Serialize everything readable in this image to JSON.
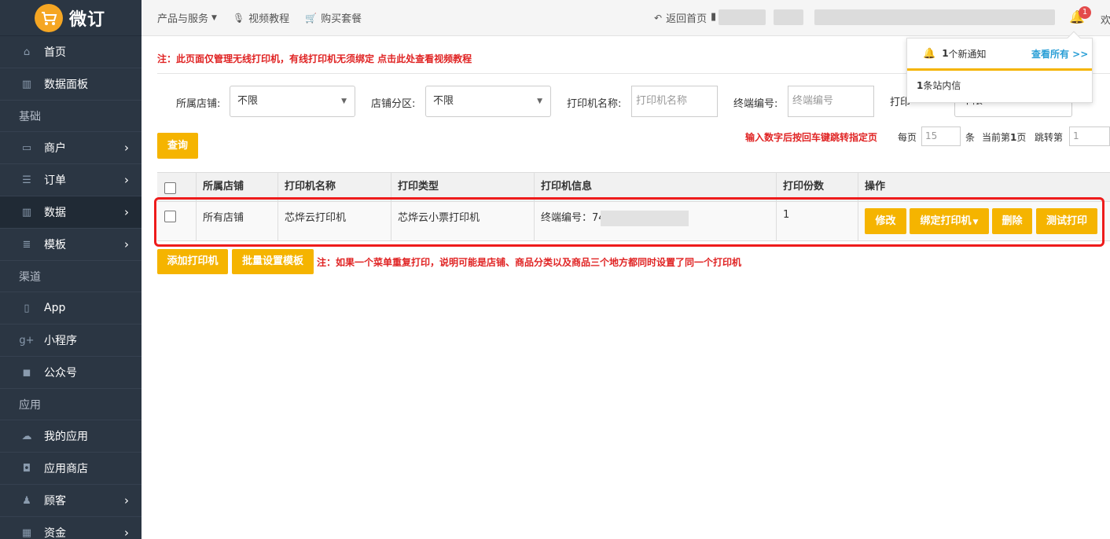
{
  "brand": {
    "name": "微订",
    "logo_icon": "cart-chat-logo",
    "accent": "#f5a623"
  },
  "sidebar": {
    "items": [
      {
        "type": "item",
        "icon": "home-icon",
        "glyph": "⌂",
        "label": "首页",
        "chevron": false
      },
      {
        "type": "item",
        "icon": "bar-chart-icon",
        "glyph": "▥",
        "label": "数据面板",
        "chevron": false
      },
      {
        "type": "section",
        "label": "基础"
      },
      {
        "type": "item",
        "icon": "laptop-icon",
        "glyph": "▭",
        "label": "商户",
        "chevron": true
      },
      {
        "type": "item",
        "icon": "list-icon",
        "glyph": "☰",
        "label": "订单",
        "chevron": true
      },
      {
        "type": "item",
        "icon": "bar-chart-icon",
        "glyph": "▥",
        "label": "数据",
        "chevron": true,
        "active": true
      },
      {
        "type": "item",
        "icon": "list-alt-icon",
        "glyph": "≣",
        "label": "模板",
        "chevron": true
      },
      {
        "type": "section",
        "label": "渠道"
      },
      {
        "type": "item",
        "icon": "tablet-icon",
        "glyph": "▯",
        "label": "App",
        "chevron": false
      },
      {
        "type": "item",
        "icon": "google-plus-icon",
        "glyph": "g+",
        "label": "小程序",
        "chevron": false
      },
      {
        "type": "item",
        "icon": "comments-icon",
        "glyph": "◼",
        "label": "公众号",
        "chevron": false
      },
      {
        "type": "section",
        "label": "应用"
      },
      {
        "type": "item",
        "icon": "cloud-icon",
        "glyph": "☁",
        "label": "我的应用",
        "chevron": false
      },
      {
        "type": "item",
        "icon": "cup-icon",
        "glyph": "◘",
        "label": "应用商店",
        "chevron": false
      },
      {
        "type": "item",
        "icon": "users-icon",
        "glyph": "♟",
        "label": "顾客",
        "chevron": true
      },
      {
        "type": "item",
        "icon": "grid-icon",
        "glyph": "▦",
        "label": "资金",
        "chevron": true
      }
    ]
  },
  "topbar": {
    "products": "产品与服务",
    "video_tutorial": "视频教程",
    "buy_package": "购买套餐",
    "back_home": "返回首页",
    "notification_count": "1",
    "welcome": "欢"
  },
  "notice_top": "注：此页面仅管理无线打印机，有线打印机无须绑定 点击此处查看视频教程",
  "filters": {
    "store_label": "所属店铺:",
    "store_value": "不限",
    "zone_label": "店铺分区:",
    "zone_value": "不限",
    "printer_name_label": "打印机名称:",
    "printer_name_placeholder": "打印机名称",
    "terminal_label": "终端编号:",
    "terminal_placeholder": "终端编号",
    "partial_label": "打印",
    "partial_value": "不限",
    "query_button": "查询"
  },
  "pager": {
    "hint": "输入数字后按回车键跳转指定页",
    "per_page": "每页",
    "per_page_value": "15",
    "unit": "条",
    "current_prefix": "当前第",
    "current_page": "1",
    "current_suffix": "页",
    "jump_label": "跳转第",
    "jump_value": "1"
  },
  "table": {
    "headers": [
      "所属店铺",
      "打印机名称",
      "打印类型",
      "打印机信息",
      "打印份数",
      "操作"
    ],
    "rows": [
      {
        "store": "所有店铺",
        "name": "芯烨云打印机",
        "type": "芯烨云小票打印机",
        "info": "终端编号：74",
        "copies": "1",
        "actions": {
          "edit": "修改",
          "bind": "绑定打印机",
          "delete": "删除",
          "test": "测试打印"
        }
      }
    ]
  },
  "bottom": {
    "add_printer": "添加打印机",
    "batch_template": "批量设置模板",
    "note": "注：如果一个菜单重复打印，说明可能是店铺、商品分类以及商品三个地方都同时设置了同一个打印机"
  },
  "popup": {
    "count": "1",
    "new_notice": "个新通知",
    "view_all": "查看所有 >>",
    "message_count": "1",
    "message_text": "条站内信"
  },
  "colors": {
    "sidebar_bg": "#2b3643",
    "button": "#f5b400",
    "warning_text": "#e02424",
    "highlight_border": "#ee1c1c",
    "link": "#2a9fd6"
  }
}
